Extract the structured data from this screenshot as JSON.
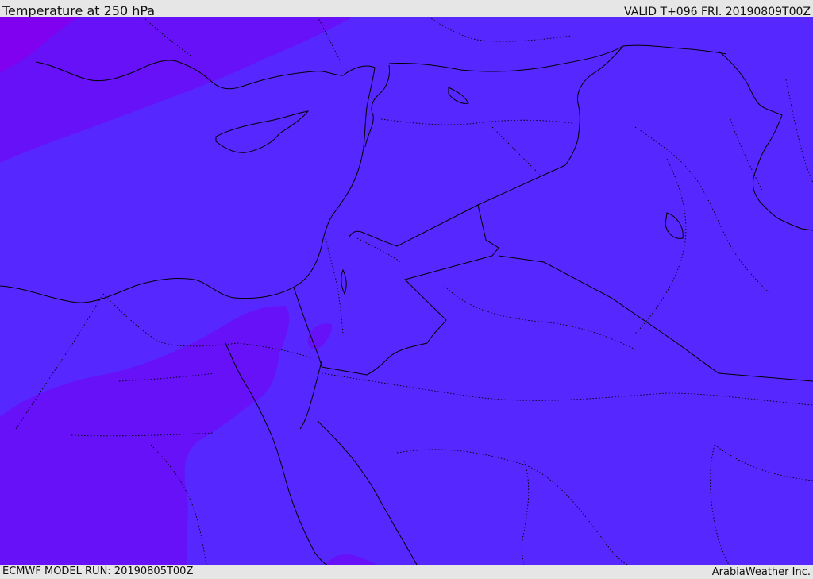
{
  "header": {
    "title": "Temperature at 250 hPa",
    "valid_time": "VALID T+096 FRI. 20190809T00Z"
  },
  "footer": {
    "model_run": "ECMWF MODEL RUN: 20190805T00Z",
    "credit": "ArabiaWeather Inc."
  },
  "map": {
    "parameter": "Temperature",
    "level": "250 hPa",
    "colors": {
      "base_field": "#5628ff",
      "band_cooler": "#6611f8",
      "band_coldest": "#8000f0",
      "coastline": "#000000",
      "border": "#000000",
      "frame_background": "#e6e6e6"
    }
  }
}
